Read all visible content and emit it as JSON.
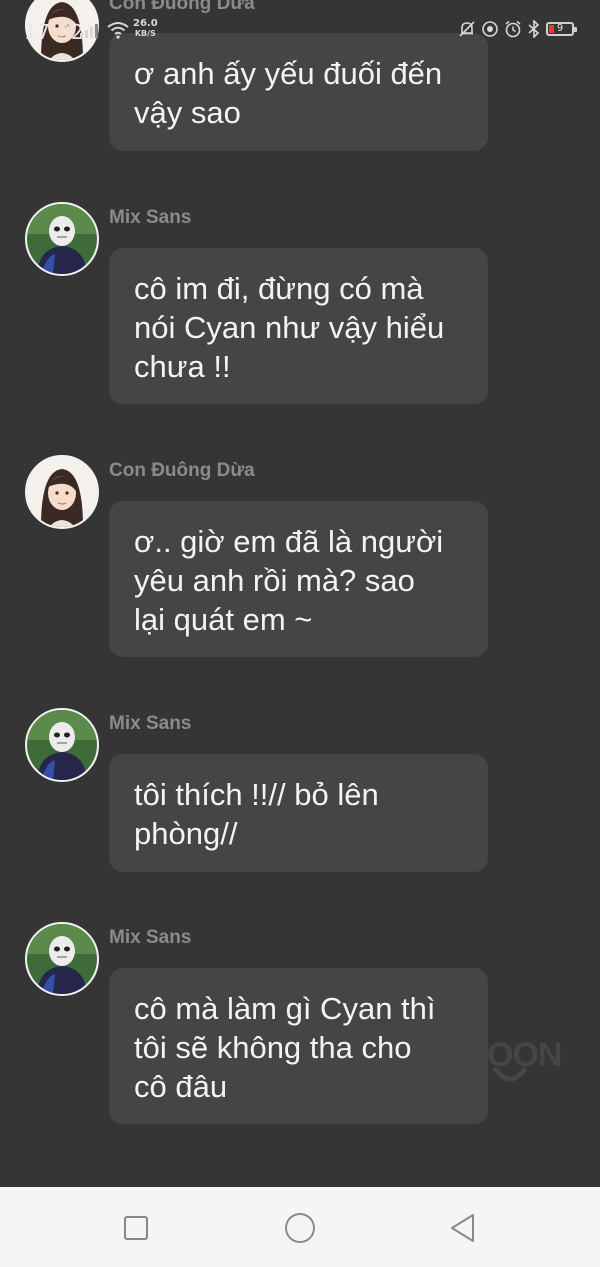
{
  "status_bar": {
    "time": "17:32",
    "speed_value": "26.0",
    "speed_unit": "KB/S",
    "battery_level": "9",
    "icons": [
      "signal-icon",
      "wifi-icon",
      "mute-icon",
      "sync-icon",
      "alarm-icon",
      "bluetooth-icon",
      "battery-icon"
    ]
  },
  "messages": [
    {
      "sender": "Con Đuông Dừa",
      "avatar": "girl-avatar",
      "lines": [
        "ơ anh ấy yếu đuối đến",
        "vậy sao"
      ]
    },
    {
      "sender": "Mix Sans",
      "avatar": "masked-boy-avatar",
      "lines": [
        "cô im đi, đừng có mà",
        "nói Cyan như vậy hiểu",
        "chưa !!"
      ]
    },
    {
      "sender": "Con Đuông Dừa",
      "avatar": "girl-avatar",
      "lines": [
        "ơ.. giờ em đã là người",
        "yêu anh rồi mà? sao",
        "lại quát em ~"
      ]
    },
    {
      "sender": "Mix Sans",
      "avatar": "masked-boy-avatar",
      "lines": [
        "tôi thích !!// bỏ lên",
        "phòng//"
      ]
    },
    {
      "sender": "Mix Sans",
      "avatar": "masked-boy-avatar",
      "lines": [
        "cô mà làm gì Cyan thì",
        "tôi sẽ không tha cho",
        "cô đâu"
      ]
    }
  ],
  "watermark": {
    "text": "OON"
  },
  "navbar": {
    "buttons": [
      "recent-apps-icon",
      "home-icon",
      "back-icon"
    ]
  },
  "colors": {
    "background": "#353535",
    "bubble": "#454545",
    "sender_text": "#8b8b8b",
    "message_text": "#f3f3f3",
    "navbar": "#f5f5f5"
  }
}
